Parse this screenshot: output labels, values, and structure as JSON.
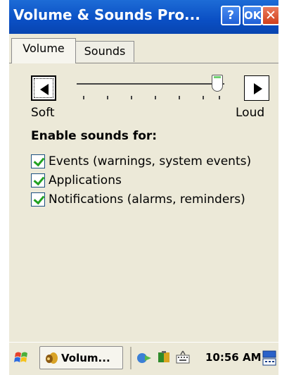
{
  "window": {
    "title": "Volume & Sounds Pro...",
    "help_label": "?",
    "ok_label": "OK",
    "close_label": "✕"
  },
  "tabs": [
    {
      "label": "Volume",
      "active": true
    },
    {
      "label": "Sounds",
      "active": false
    }
  ],
  "volume": {
    "left_label": "Soft",
    "right_label": "Loud",
    "level": 0.95
  },
  "sounds": {
    "heading": "Enable sounds for:",
    "options": [
      {
        "label": "Events (warnings, system events)",
        "checked": true
      },
      {
        "label": "Applications",
        "checked": true
      },
      {
        "label": "Notifications (alarms, reminders)",
        "checked": true
      }
    ]
  },
  "taskbar": {
    "task_label": "Volum...",
    "clock": "10:56 AM",
    "icons": [
      "start-flag-icon",
      "volume-app-icon",
      "network-icon",
      "sync-icon",
      "keyboard-icon",
      "input-panel-icon"
    ]
  }
}
